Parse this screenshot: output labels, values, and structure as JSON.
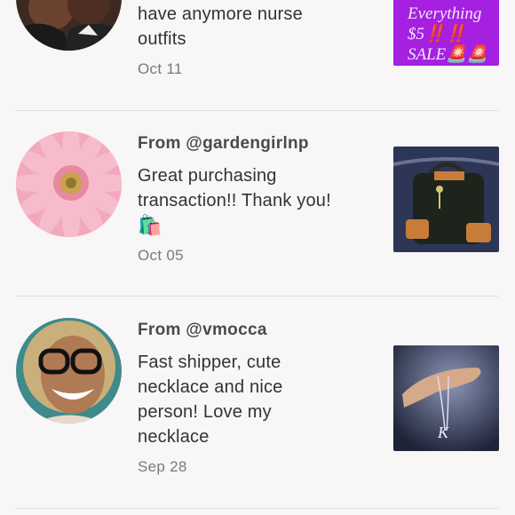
{
  "reviews": [
    {
      "text_lines": [
        "have anymore nurse",
        "outfits"
      ],
      "date": "Oct 11",
      "thumb_lines": [
        "Everything",
        "$5‼️‼️",
        "SALE🚨🚨"
      ]
    },
    {
      "from_prefix": "From",
      "handle": "@gardengirlnp",
      "text_lines": [
        "Great purchasing",
        "transaction!! Thank you!",
        "🛍️"
      ],
      "date": "Oct 05"
    },
    {
      "from_prefix": "From",
      "handle": "@vmocca",
      "text_lines": [
        "Fast shipper, cute",
        "necklace and nice",
        "person! Love my",
        "necklace"
      ],
      "date": "Sep 28"
    }
  ],
  "colors": {
    "thumb1_purple": "#a520e0",
    "thumb1_text": "#f4e9ff"
  }
}
